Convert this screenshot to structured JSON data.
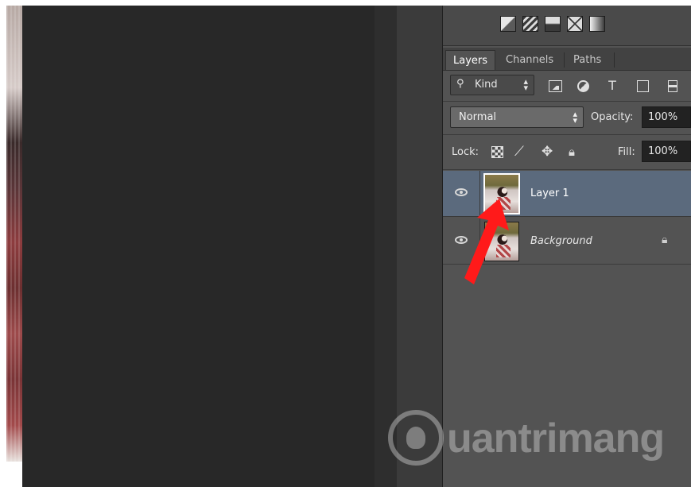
{
  "adjustments": {
    "icons": [
      "levels-icon",
      "curves-icon",
      "gradient-map-icon",
      "channel-mixer-icon",
      "posterize-icon"
    ]
  },
  "layers_panel": {
    "tabs": [
      {
        "label": "Layers",
        "active": true
      },
      {
        "label": "Channels",
        "active": false
      },
      {
        "label": "Paths",
        "active": false
      }
    ],
    "filter": {
      "kind_label": "Kind",
      "icons": [
        "pixel-layer-filter-icon",
        "adjustment-layer-filter-icon",
        "type-layer-filter-icon",
        "shape-layer-filter-icon",
        "smart-object-filter-icon"
      ],
      "type_glyph": "T"
    },
    "blend_mode": "Normal",
    "opacity_label": "Opacity:",
    "opacity_value": "100%",
    "lock_label": "Lock:",
    "fill_label": "Fill:",
    "fill_value": "100%",
    "layers": [
      {
        "name": "Layer 1",
        "selected": true,
        "visible": true,
        "locked": false
      },
      {
        "name": "Background",
        "selected": false,
        "visible": true,
        "locked": true
      }
    ]
  },
  "annotation": {
    "arrow_color": "#ff1a1a"
  },
  "watermark": {
    "text": "uantrimang"
  },
  "colors": {
    "panel_bg": "#535353",
    "selected_row": "#5b6a7d",
    "canvas_bg": "#282828"
  }
}
